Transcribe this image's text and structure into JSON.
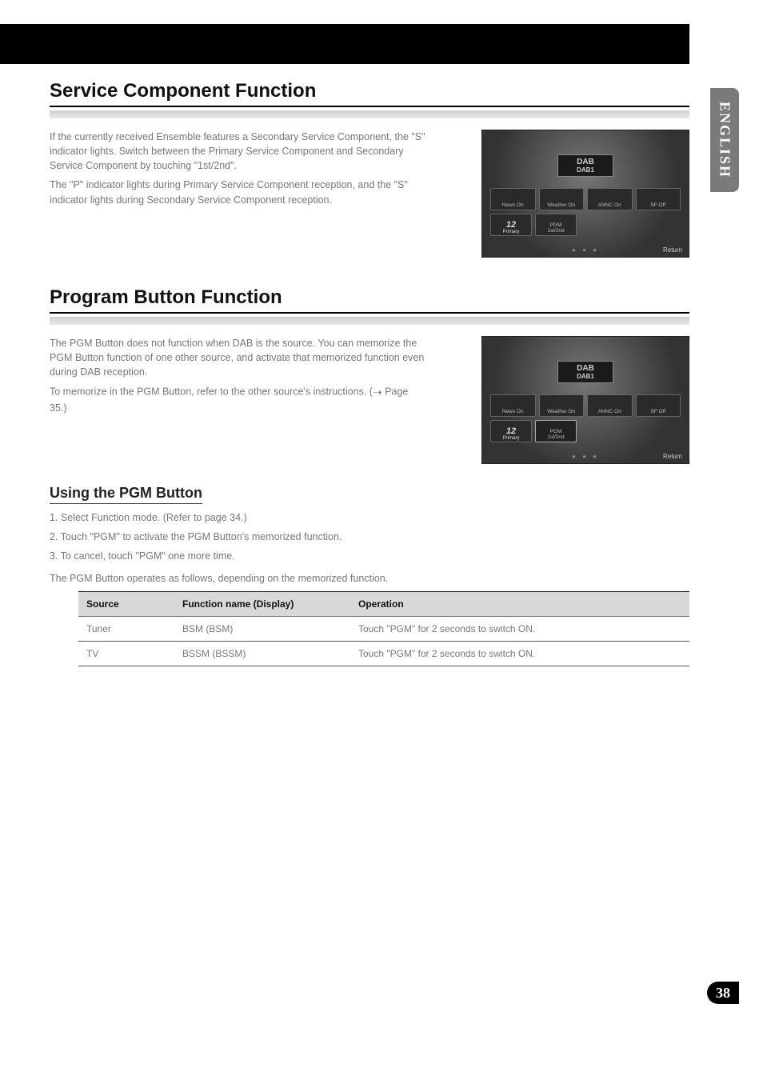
{
  "language_tab": "ENGLISH",
  "page_number": "38",
  "section1": {
    "title": "Service Component Function",
    "paragraphs": [
      "If the currently received Ensemble features a Secondary Service Component, the \"S\" indicator lights. Switch between the Primary Service Component and Secondary Service Component by touching \"1st/2nd\".",
      "The \"P\" indicator lights during Primary Service Component reception, and the \"S\" indicator lights during Secondary Service Component reception."
    ]
  },
  "section2": {
    "title": "Program Button Function",
    "intro": [
      "The PGM Button does not function when DAB is the source. You can memorize the PGM Button function of one other source, and activate that memorized function even during DAB reception."
    ],
    "memo_label": "To memorize in the PGM Button, refer to the other source's instructions. (",
    "memo_cont": " Page 35.)"
  },
  "subheading": "Using the PGM Button",
  "steps": [
    "1. Select Function mode. (Refer to page 34.)",
    "2. Touch \"PGM\" to activate the PGM Button's memorized function.",
    "3. To cancel, touch \"PGM\" one more time.",
    "The PGM Button operates as follows, depending on the memorized function."
  ],
  "table": {
    "headers": [
      "Source",
      "Function name (Display)",
      "Operation"
    ],
    "rows": [
      [
        "Tuner",
        "BSM (BSM)",
        "Touch \"PGM\" for 2 seconds to switch ON."
      ],
      [
        "TV",
        "BSSM (BSSM)",
        "Touch \"PGM\" for 2 seconds to switch ON."
      ]
    ]
  },
  "screenshot": {
    "brand": "DAB",
    "band": "DAB1",
    "buttons_row1": [
      "News On",
      "Weather On",
      "ANNC On",
      "SF Off"
    ],
    "preset_number": "12",
    "preset_label": "Primary",
    "pgm_label": "PGM",
    "pgm_sub": "1st/2nd",
    "return": "Return",
    "dots": "● ● ●"
  }
}
